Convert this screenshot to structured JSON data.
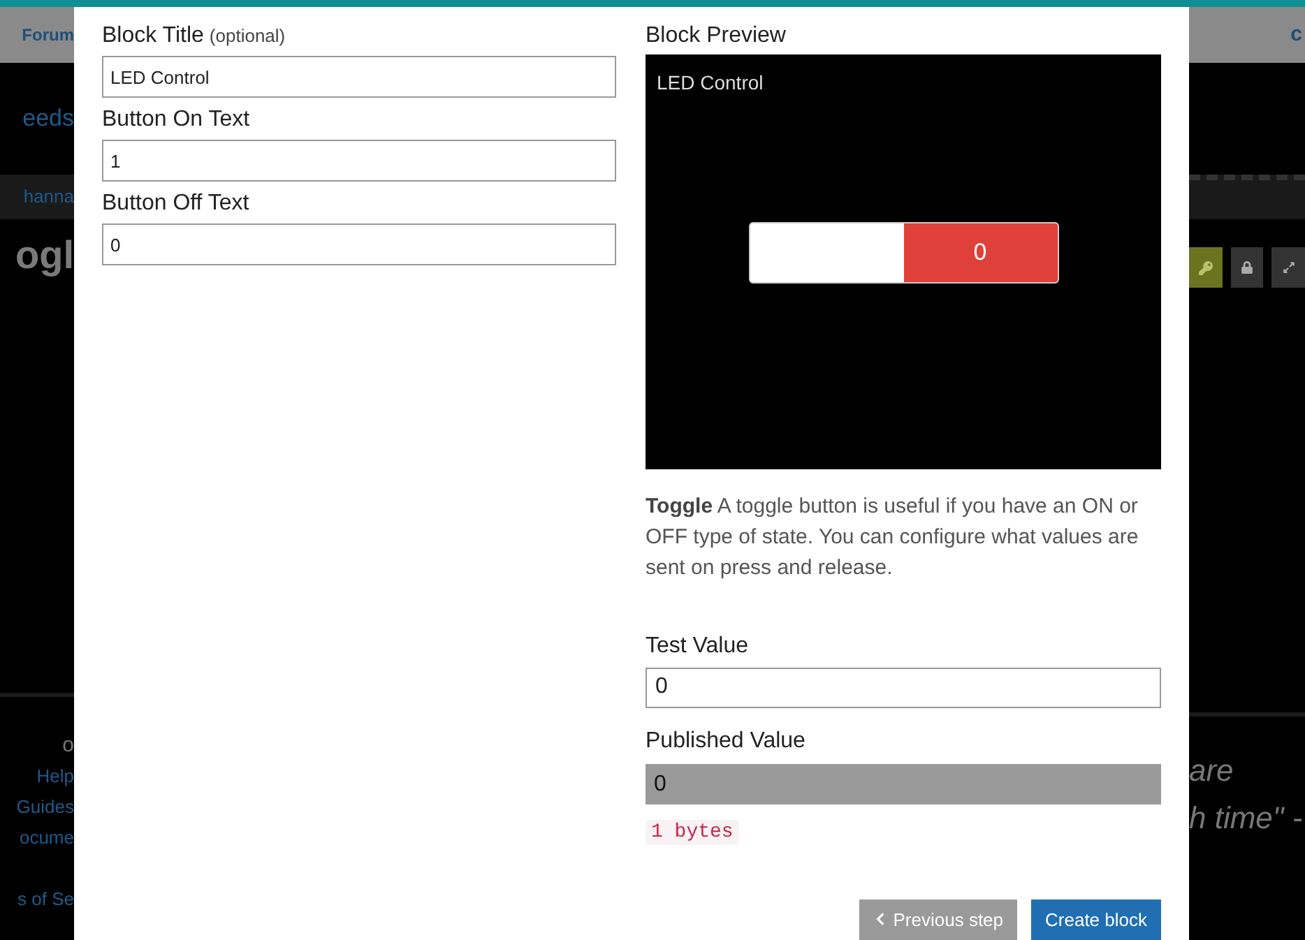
{
  "background": {
    "left": {
      "header_link": "Forum",
      "nav_link": "eeds",
      "breadcrumb": "hanna",
      "heading": "ogl",
      "footer_heading": "o",
      "footer_links": [
        "Help",
        "Guides",
        "ocume",
        "s of Se"
      ]
    },
    "right": {
      "header_link": "c",
      "tools": [
        {
          "kind": "key",
          "active": true
        },
        {
          "kind": "lock",
          "active": false
        },
        {
          "kind": "expand",
          "active": false
        }
      ],
      "quote_lines": [
        "are",
        "h time\" -"
      ]
    }
  },
  "form": {
    "fields": [
      {
        "label": "Block Title",
        "hint": "(optional)",
        "value": "LED Control"
      },
      {
        "label": "Button On Text",
        "value": "1"
      },
      {
        "label": "Button Off Text",
        "value": "0"
      }
    ]
  },
  "preview": {
    "title": "Block Preview",
    "block_title": "LED Control",
    "toggle": {
      "label": "0",
      "on": false
    }
  },
  "description": "**Toggle** A toggle button is useful if you have an ON or OFF type of state. You can configure what values are sent on press and release.",
  "test_value": {
    "label": "Test Value",
    "value": "0"
  },
  "published_value": {
    "label": "Published Value",
    "value": "0",
    "byte_count": "1 bytes"
  },
  "buttons": [
    {
      "label": "Previous step",
      "kind": "secondary"
    },
    {
      "label": "Create block",
      "kind": "primary"
    }
  ]
}
